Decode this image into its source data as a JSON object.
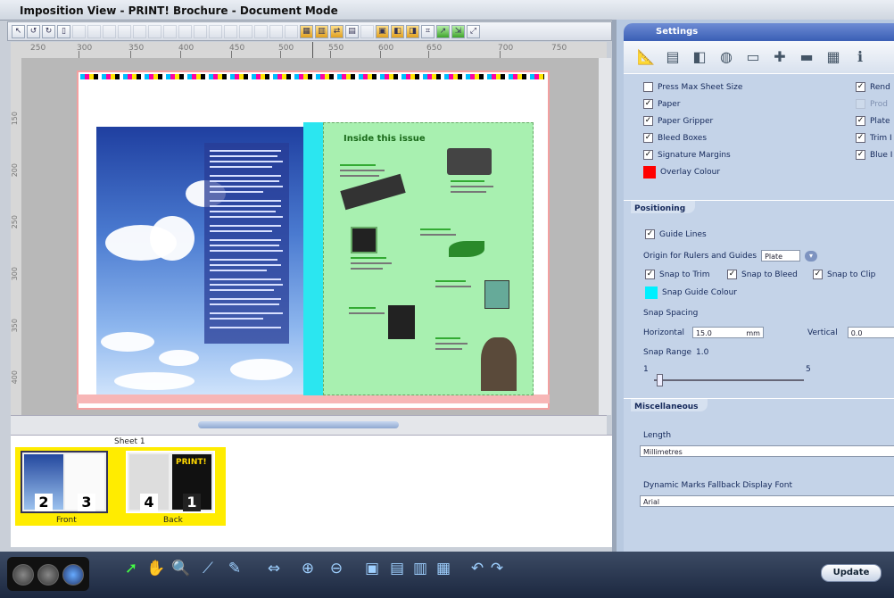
{
  "window": {
    "title": "Imposition View - PRINT! Brochure - Document Mode"
  },
  "ruler": {
    "marks": [
      "250",
      "300",
      "350",
      "400",
      "450",
      "500",
      "550",
      "600",
      "650",
      "700",
      "750"
    ]
  },
  "vruler": {
    "marks": [
      "150",
      "200",
      "250",
      "300",
      "350",
      "400"
    ]
  },
  "page": {
    "right_heading": "Inside this issue"
  },
  "thumbnails": {
    "sheet_label": "Sheet 1",
    "front": {
      "label": "Front",
      "left_num": "2",
      "right_num": "3"
    },
    "back": {
      "label": "Back",
      "left_num": "4",
      "right_num": "1",
      "brand": "PRINT!"
    }
  },
  "settings": {
    "header": "Settings",
    "display": {
      "left": [
        {
          "label": "Press Max Sheet Size",
          "checked": false
        },
        {
          "label": "Paper",
          "checked": true
        },
        {
          "label": "Paper Gripper",
          "checked": true
        },
        {
          "label": "Bleed Boxes",
          "checked": true
        },
        {
          "label": "Signature Margins",
          "checked": true
        }
      ],
      "right": [
        {
          "label": "Rend",
          "checked": true
        },
        {
          "label": "Prod",
          "checked": false
        },
        {
          "label": "Plate",
          "checked": true
        },
        {
          "label": "Trim I",
          "checked": true
        },
        {
          "label": "Blue I",
          "checked": true
        }
      ],
      "overlay_label": "Overlay Colour",
      "overlay_color": "#ff0000"
    },
    "positioning": {
      "title": "Positioning",
      "guide_lines": "Guide Lines",
      "origin_label": "Origin for Rulers and Guides",
      "origin_value": "Plate",
      "snap_trim": "Snap to Trim",
      "snap_bleed": "Snap to Bleed",
      "snap_clip": "Snap to Clip",
      "snap_guide_colour": "Snap Guide Colour",
      "snap_guide_color": "#00f0ff",
      "snap_spacing": "Snap Spacing",
      "horizontal_label": "Horizontal",
      "horizontal_value": "15.0",
      "unit": "mm",
      "vertical_label": "Vertical",
      "vertical_value": "0.0",
      "snap_range_label": "Snap Range",
      "snap_range_value": "1.0",
      "range_min": "1",
      "range_max": "5"
    },
    "misc": {
      "title": "Miscellaneous",
      "length_label": "Length",
      "length_value": "Millimetres",
      "font_label": "Dynamic Marks Fallback Display Font",
      "font_value": "Arial"
    },
    "update_button": "Update"
  }
}
